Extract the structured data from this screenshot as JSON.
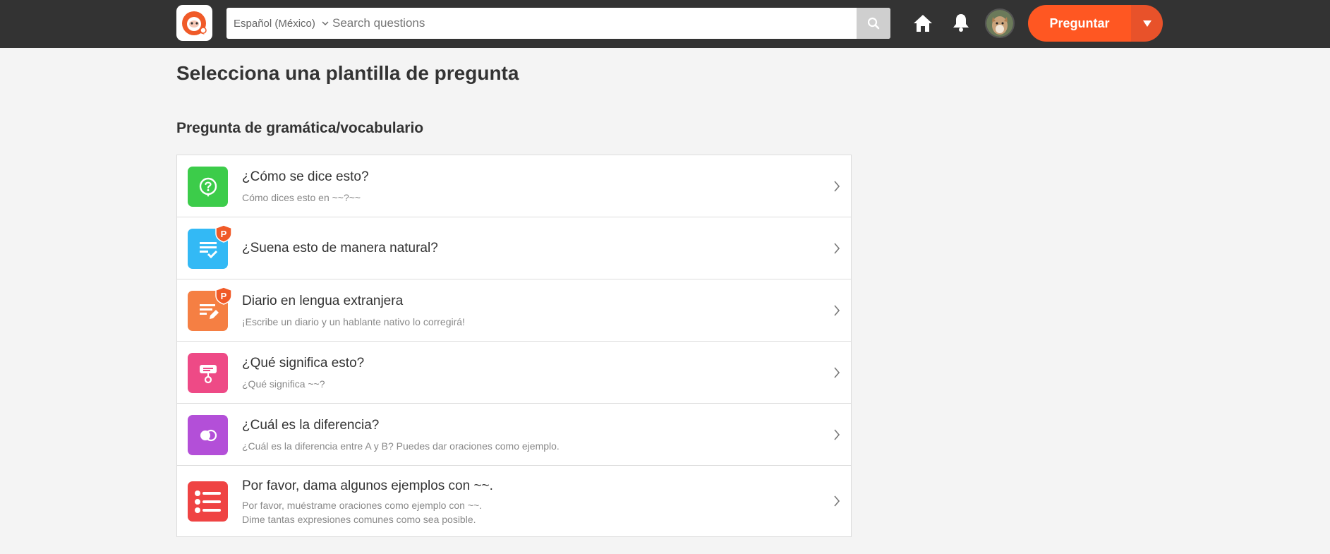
{
  "header": {
    "language_label": "Español (México)",
    "search_placeholder": "Search questions",
    "ask_button_label": "Preguntar",
    "icons": [
      "logo-icon",
      "chevron-down-icon",
      "search-icon",
      "home-icon",
      "bell-icon",
      "avatar",
      "caret-down-icon"
    ],
    "brand_color": "#ff5722",
    "bar_color": "#333333"
  },
  "page": {
    "title": "Selecciona una plantilla de pregunta",
    "section_title": "Pregunta de gramática/vocabulario"
  },
  "templates": [
    {
      "title": "¿Cómo se dice esto?",
      "subtitle": "Cómo dices esto en ~~?~~",
      "subtitle2": "",
      "icon": "question-bubble-icon",
      "color": "#3ccc4a",
      "premium": false
    },
    {
      "title": "¿Suena esto de manera natural?",
      "subtitle": "",
      "subtitle2": "",
      "icon": "list-check-icon",
      "color": "#33b9f5",
      "premium": true
    },
    {
      "title": "Diario en lengua extranjera",
      "subtitle": "¡Escribe un diario y un hablante nativo lo corregirá!",
      "subtitle2": "",
      "icon": "edit-lines-icon",
      "color": "#f57f43",
      "premium": true
    },
    {
      "title": "¿Qué significa esto?",
      "subtitle": "¿Qué significa ~~?",
      "subtitle2": "",
      "icon": "sign-icon",
      "color": "#ee4a86",
      "premium": false
    },
    {
      "title": "¿Cuál es la diferencia?",
      "subtitle": "¿Cuál es la diferencia entre A y B? Puedes dar oraciones como ejemplo.",
      "subtitle2": "",
      "icon": "circles-compare-icon",
      "color": "#b34fd8",
      "premium": false
    },
    {
      "title": "Por favor, dama algunos ejemplos con ~~.",
      "subtitle": "Por favor, muéstrame oraciones como ejemplo con ~~.",
      "subtitle2": "Dime tantas expresiones comunes como sea posible.",
      "icon": "bulleted-list-icon",
      "color": "#ef4343",
      "premium": false
    }
  ],
  "premium_badge_label": "P"
}
